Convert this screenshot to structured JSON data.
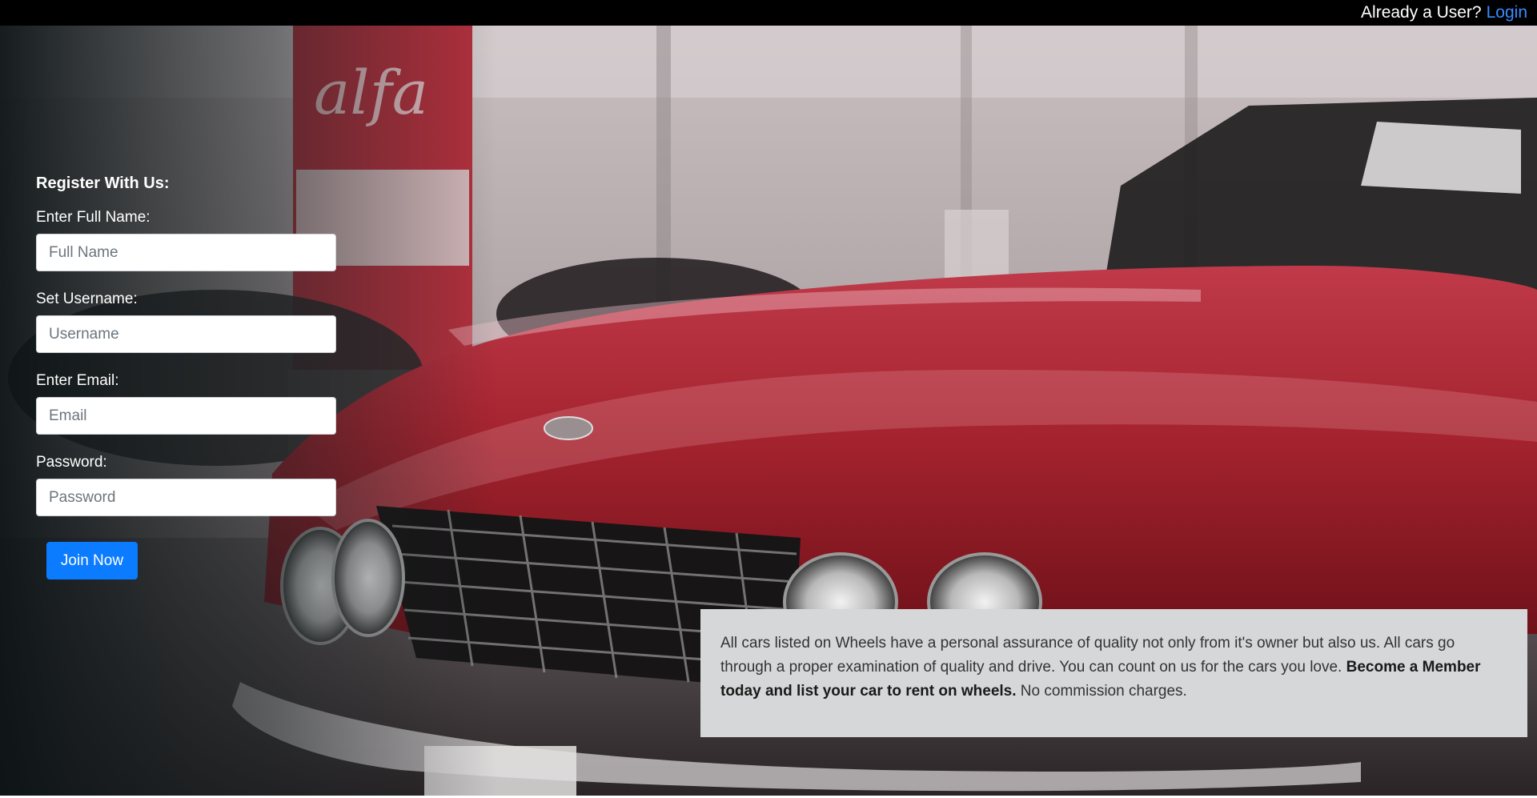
{
  "topbar": {
    "prompt": "Already a User?",
    "login_label": "Login"
  },
  "register": {
    "heading": "Register With Us:",
    "fields": [
      {
        "label": "Enter Full Name:",
        "placeholder": "Full Name"
      },
      {
        "label": "Set Username:",
        "placeholder": "Username"
      },
      {
        "label": "Enter Email:",
        "placeholder": "Email"
      },
      {
        "label": "Password:",
        "placeholder": "Password"
      }
    ],
    "submit_label": "Join Now"
  },
  "info": {
    "text_1": "All cars listed on Wheels have a personal assurance of quality not only from it's owner but also us. All cars go through a proper examination of quality and drive. You can count on us for the cars you love. ",
    "bold_text": "Become a Member today and list your car to rent on wheels.",
    "text_2": " No commission charges."
  },
  "colors": {
    "topbar_bg": "#000000",
    "link": "#3b8cff",
    "button": "#0b7bff",
    "info_bg": "#d6d7d8"
  }
}
